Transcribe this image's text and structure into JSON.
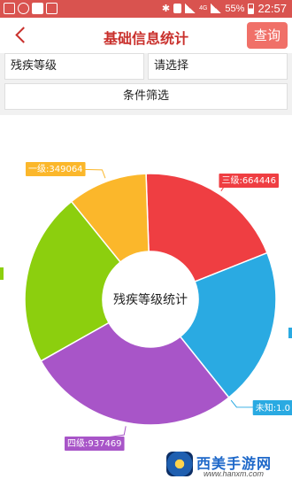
{
  "status_bar": {
    "battery": "55%",
    "time": "22:57",
    "network": "4G",
    "network_small": "46"
  },
  "header": {
    "title": "基础信息统计",
    "query_label": "查询"
  },
  "filters": {
    "category": {
      "value": "残疾等级"
    },
    "level": {
      "value": "请选择"
    },
    "filter_label": "条件筛选"
  },
  "chart_data": {
    "type": "pie",
    "center_label": "残疾等级统计",
    "donut": true,
    "slices": [
      {
        "label": "三级",
        "value": 664446,
        "color": "#ef3e42",
        "callout": "三级:664446"
      },
      {
        "label": "",
        "value": 690000,
        "color": "#2aaae2",
        "callout": ""
      },
      {
        "label": "未知",
        "value": 1.0,
        "color": "#2aaae2",
        "callout": "未知:1.0"
      },
      {
        "label": "四级",
        "value": 937469,
        "color": "#a855c8",
        "callout": "四级:937469"
      },
      {
        "label": "",
        "value": 760000,
        "color": "#8ccf0e",
        "callout": ""
      },
      {
        "label": "一级",
        "value": 349064,
        "color": "#fbb72b",
        "callout": "一级:349064"
      }
    ]
  },
  "watermark": {
    "name": "西美手游网",
    "url": "www.hanxm.com"
  }
}
